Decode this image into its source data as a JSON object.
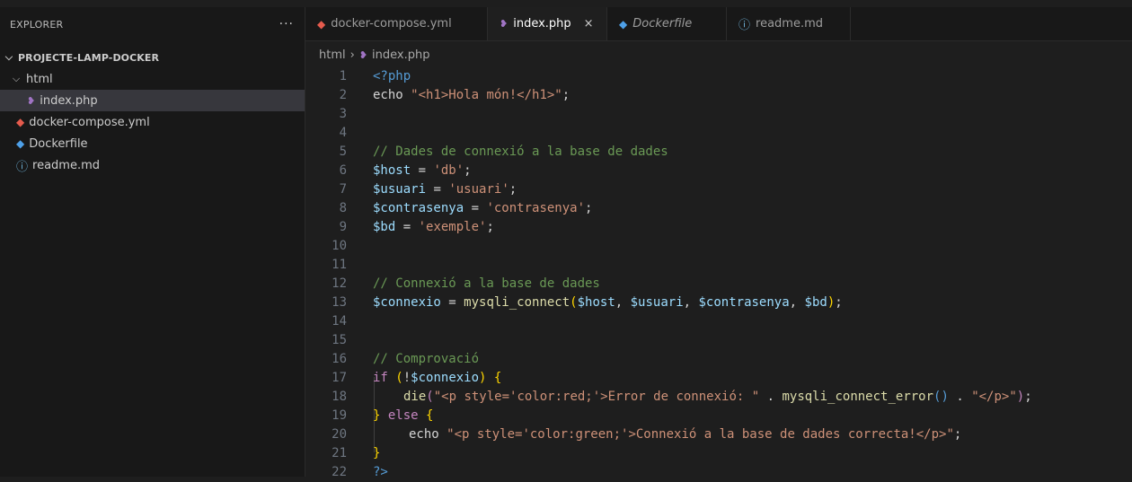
{
  "explorer": {
    "title": "EXPLORER",
    "more": "···",
    "root": "PROJECTE-LAMP-DOCKER",
    "items": [
      {
        "label": "html",
        "type": "folder",
        "icon": "chevron-down-icon"
      },
      {
        "label": "index.php",
        "type": "file",
        "icon": "php-file-icon"
      },
      {
        "label": "docker-compose.yml",
        "type": "file",
        "icon": "docker-compose-icon"
      },
      {
        "label": "Dockerfile",
        "type": "file",
        "icon": "docker-icon"
      },
      {
        "label": "readme.md",
        "type": "file",
        "icon": "info-icon"
      }
    ]
  },
  "tabs": [
    {
      "label": "docker-compose.yml",
      "icon": "docker-compose-icon"
    },
    {
      "label": "index.php",
      "icon": "php-file-icon",
      "close": "×"
    },
    {
      "label": "Dockerfile",
      "icon": "docker-icon"
    },
    {
      "label": "readme.md",
      "icon": "info-icon"
    }
  ],
  "breadcrumb": {
    "folder": "html",
    "sep": "›",
    "file": "index.php"
  },
  "code": {
    "numbers": [
      "1",
      "2",
      "3",
      "4",
      "5",
      "6",
      "7",
      "8",
      "9",
      "10",
      "11",
      "12",
      "13",
      "14",
      "15",
      "16",
      "17",
      "18",
      "19",
      "20",
      "21",
      "22"
    ],
    "l1": {
      "a": "<?php"
    },
    "l2": {
      "a": "echo",
      "b": " ",
      "c": "\"<h1>Hola món!</h1>\"",
      "d": ";"
    },
    "l5": {
      "a": "// Dades de connexió a la base de dades"
    },
    "l6": {
      "a": "$host",
      "b": " = ",
      "c": "'db'",
      "d": ";"
    },
    "l7": {
      "a": "$usuari",
      "b": " = ",
      "c": "'usuari'",
      "d": ";"
    },
    "l8": {
      "a": "$contrasenya",
      "b": " = ",
      "c": "'contrasenya'",
      "d": ";"
    },
    "l9": {
      "a": "$bd",
      "b": " = ",
      "c": "'exemple'",
      "d": ";"
    },
    "l12": {
      "a": "// Connexió a la base de dades"
    },
    "l13": {
      "a": "$connexio",
      "b": " = ",
      "c": "mysqli_connect",
      "d": "(",
      "e": "$host",
      "f": ", ",
      "g": "$usuari",
      "h": ", ",
      "i": "$contrasenya",
      "j": ", ",
      "k": "$bd",
      "l": ")",
      "m": ";"
    },
    "l16": {
      "a": "// Comprovació"
    },
    "l17": {
      "a": "if",
      "b": " ",
      "c": "(",
      "d": "!",
      "e": "$connexio",
      "f": ")",
      "g": " ",
      "h": "{"
    },
    "l18": {
      "a": "die",
      "b": "(",
      "c": "\"<p style='color:red;'>Error de connexió: \"",
      "d": " . ",
      "e": "mysqli_connect_error",
      "f": "()",
      "g": " . ",
      "h": "\"</p>\"",
      "i": ")",
      "j": ";"
    },
    "l19": {
      "a": "}",
      "b": " ",
      "c": "else",
      "d": " ",
      "e": "{"
    },
    "l20": {
      "a": "echo",
      "b": " ",
      "c": "\"<p style='color:green;'>Connexió a la base de dades correcta!</p>\"",
      "d": ";"
    },
    "l21": {
      "a": "}"
    },
    "l22": {
      "a": "?>"
    }
  }
}
